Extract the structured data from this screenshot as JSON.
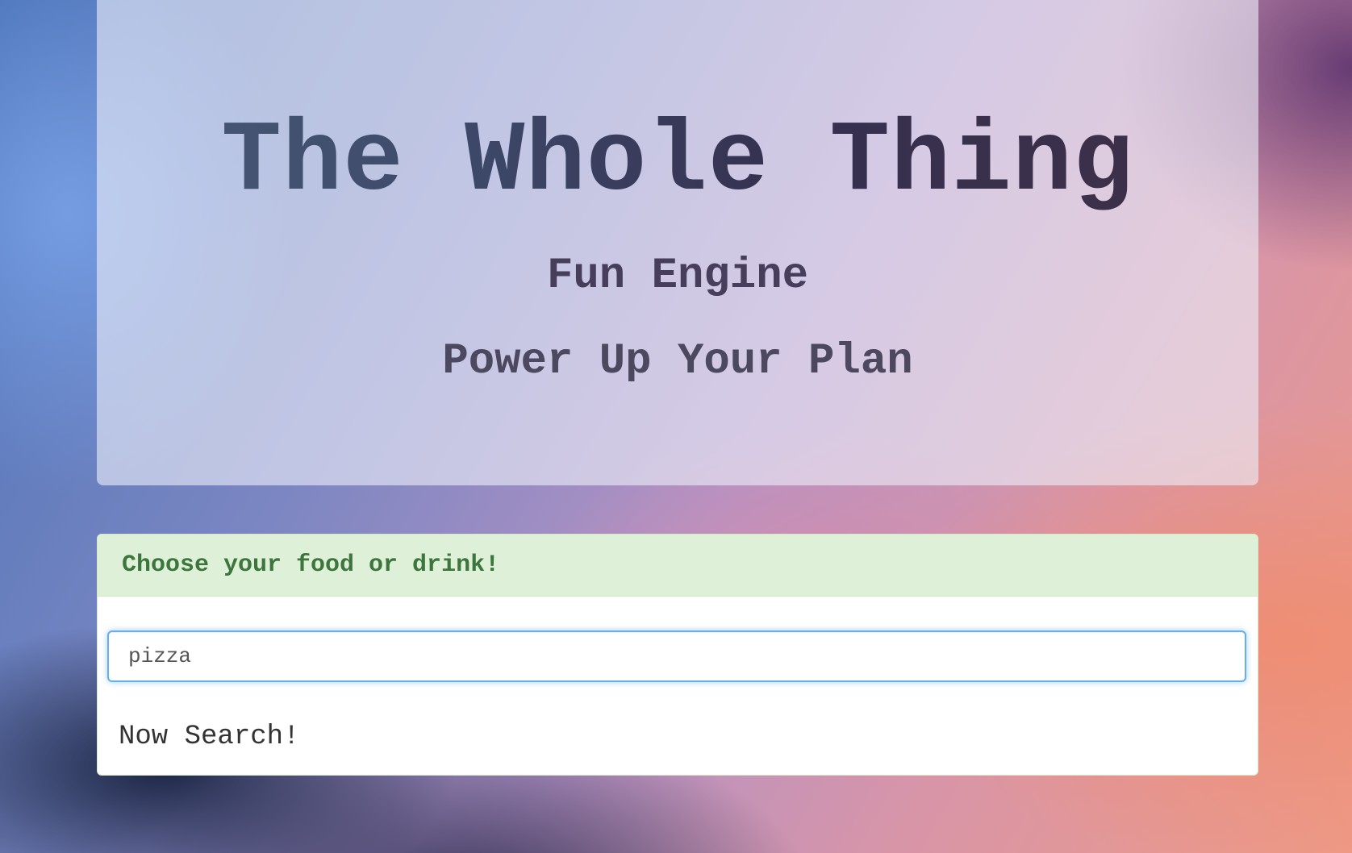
{
  "hero": {
    "title": "The Whole Thing",
    "subtitle": "Fun Engine",
    "tagline": "Power Up Your Plan"
  },
  "search_panel": {
    "heading": "Choose your food or drink!",
    "input_value": "pizza",
    "button_label": "Now Search!"
  },
  "colors": {
    "panel_heading_bg": "#dff0d8",
    "panel_heading_text": "#3c763d",
    "input_focus_border": "#66afe9"
  }
}
